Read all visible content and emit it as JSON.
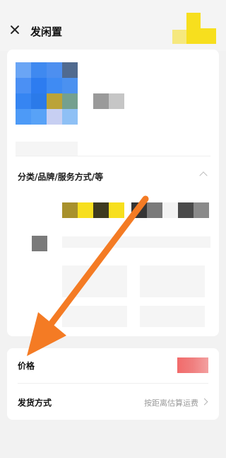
{
  "header": {
    "title": "发闲置"
  },
  "sections": {
    "category": {
      "label": "分类/品牌/服务方式/等"
    }
  },
  "rows": [
    {
      "label": "价格"
    },
    {
      "label": "发货方式",
      "hint": "按距离估算运费"
    }
  ],
  "colors": {
    "arrow": "#f47b24",
    "price_badge": "#f26b6b",
    "brand_yellow": "#f7df1e"
  }
}
